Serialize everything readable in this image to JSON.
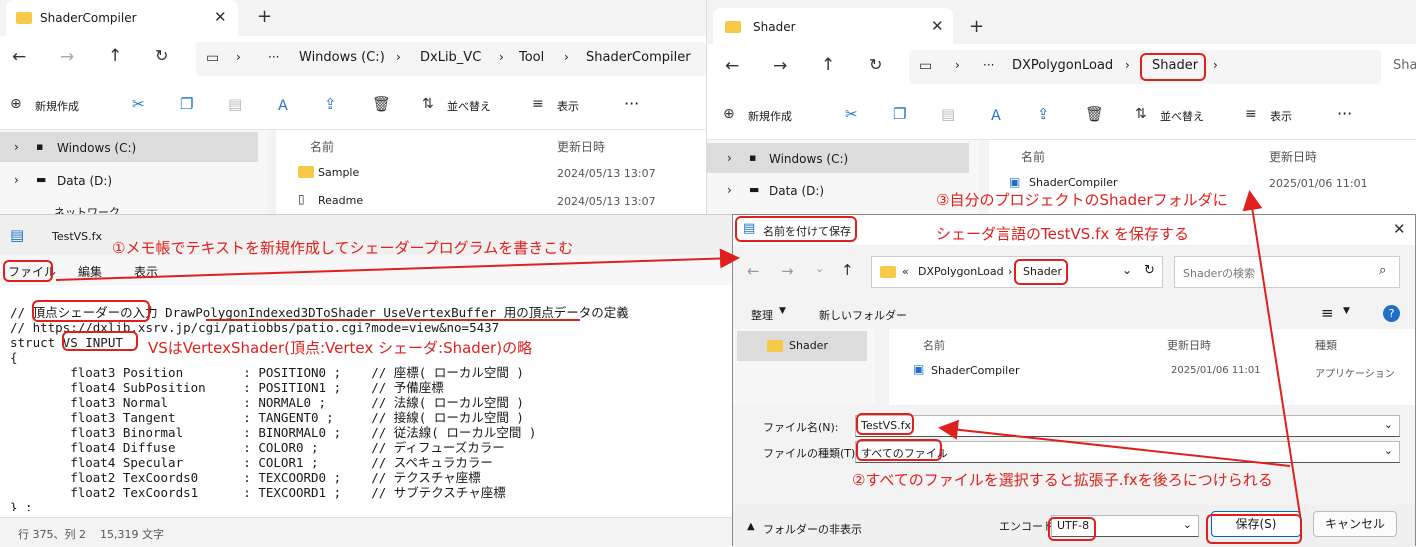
{
  "explorer1": {
    "tab_title": "ShaderCompiler",
    "breadcrumb": [
      "Windows (C:)",
      "DxLib_VC",
      "Tool",
      "ShaderCompiler"
    ],
    "toolbar": {
      "new": "新規作成",
      "sort": "並べ替え",
      "view": "表示"
    },
    "nav": [
      "Windows (C:)",
      "Data (D:)",
      "ネットワーク"
    ],
    "columns": {
      "name": "名前",
      "date": "更新日時"
    },
    "files": [
      {
        "name": "Sample",
        "date": "2024/05/13 13:07"
      },
      {
        "name": "Readme",
        "date": "2024/05/13 13:07"
      }
    ]
  },
  "explorer2": {
    "tab_title": "Shader",
    "breadcrumb": [
      "DXPolygonLoad",
      "Shader"
    ],
    "search": "Sha",
    "toolbar": {
      "new": "新規作成",
      "sort": "並べ替え",
      "view": "表示"
    },
    "nav": [
      "Windows (C:)",
      "Data (D:)"
    ],
    "columns": {
      "name": "名前",
      "date": "更新日時"
    },
    "files": [
      {
        "name": "ShaderCompiler",
        "date": "2025/01/06 11:01"
      }
    ]
  },
  "notepad": {
    "tab_title": "TestVS.fx",
    "menu": {
      "file": "ファイル",
      "edit": "編集",
      "view": "表示"
    },
    "lines": [
      "// 頂点シェーダーの入力 DrawPolygonIndexed3DToShader_UseVertexBuffer 用の頂点データの定義",
      "// https://dxlib.xsrv.jp/cgi/patiobbs/patio.cgi?mode=view&no=5437",
      "struct VS_INPUT",
      "{",
      "        float3 Position        : POSITION0 ;    // 座標( ローカル空間 )",
      "        float4 SubPosition     : POSITION1 ;    // 予備座標",
      "        float3 Normal          : NORMAL0 ;      // 法線( ローカル空間 )",
      "        float3 Tangent         : TANGENT0 ;     // 接線( ローカル空間 )",
      "        float3 Binormal        : BINORMAL0 ;    // 従法線( ローカル空間 )",
      "        float4 Diffuse         : COLOR0 ;       // ディフューズカラー",
      "        float4 Specular        : COLOR1 ;       // スペキュラカラー",
      "        float2 TexCoords0      : TEXCOORD0 ;    // テクスチャ座標",
      "        float2 TexCoords1      : TEXCOORD1 ;    // サブテクスチャ座標",
      "} ;"
    ],
    "status": {
      "position": "行 375、列 2",
      "chars": "15,319 文字"
    }
  },
  "dialog": {
    "title": "名前を付けて保存",
    "breadcrumb": [
      "DXPolygonLoad",
      "Shader"
    ],
    "search_placeholder": "Shaderの検索",
    "organize": "整理",
    "new_folder": "新しいフォルダー",
    "nav": [
      "Shader"
    ],
    "columns": {
      "name": "名前",
      "date": "更新日時",
      "type": "種類"
    },
    "files": [
      {
        "name": "ShaderCompiler",
        "date": "2025/01/06 11:01",
        "type": "アプリケーション"
      }
    ],
    "filename_label": "ファイル名(N):",
    "filename": "TestVS.fx",
    "filetype_label": "ファイルの種類(T):",
    "filetype": "すべてのファイル",
    "hide_folders": "フォルダーの非表示",
    "encoding_label": "エンコード:",
    "encoding": "UTF-8",
    "save": "保存(S)",
    "cancel": "キャンセル"
  },
  "annotations": {
    "a1": "①メモ帳でテキストを新規作成してシェーダープログラムを書きこむ",
    "a_vs": "VSはVertexShader(頂点:Vertex シェーダ:Shader)の略",
    "a3": "③自分のプロジェクトのShaderフォルダに",
    "a3b": "シェーダ言語のTestVS.fx を保存する",
    "a2": "②すべてのファイルを選択すると拡張子.fxを後ろにつけられる"
  },
  "colors": {
    "annotation": "#e0201c",
    "accent": "#0067c0"
  }
}
